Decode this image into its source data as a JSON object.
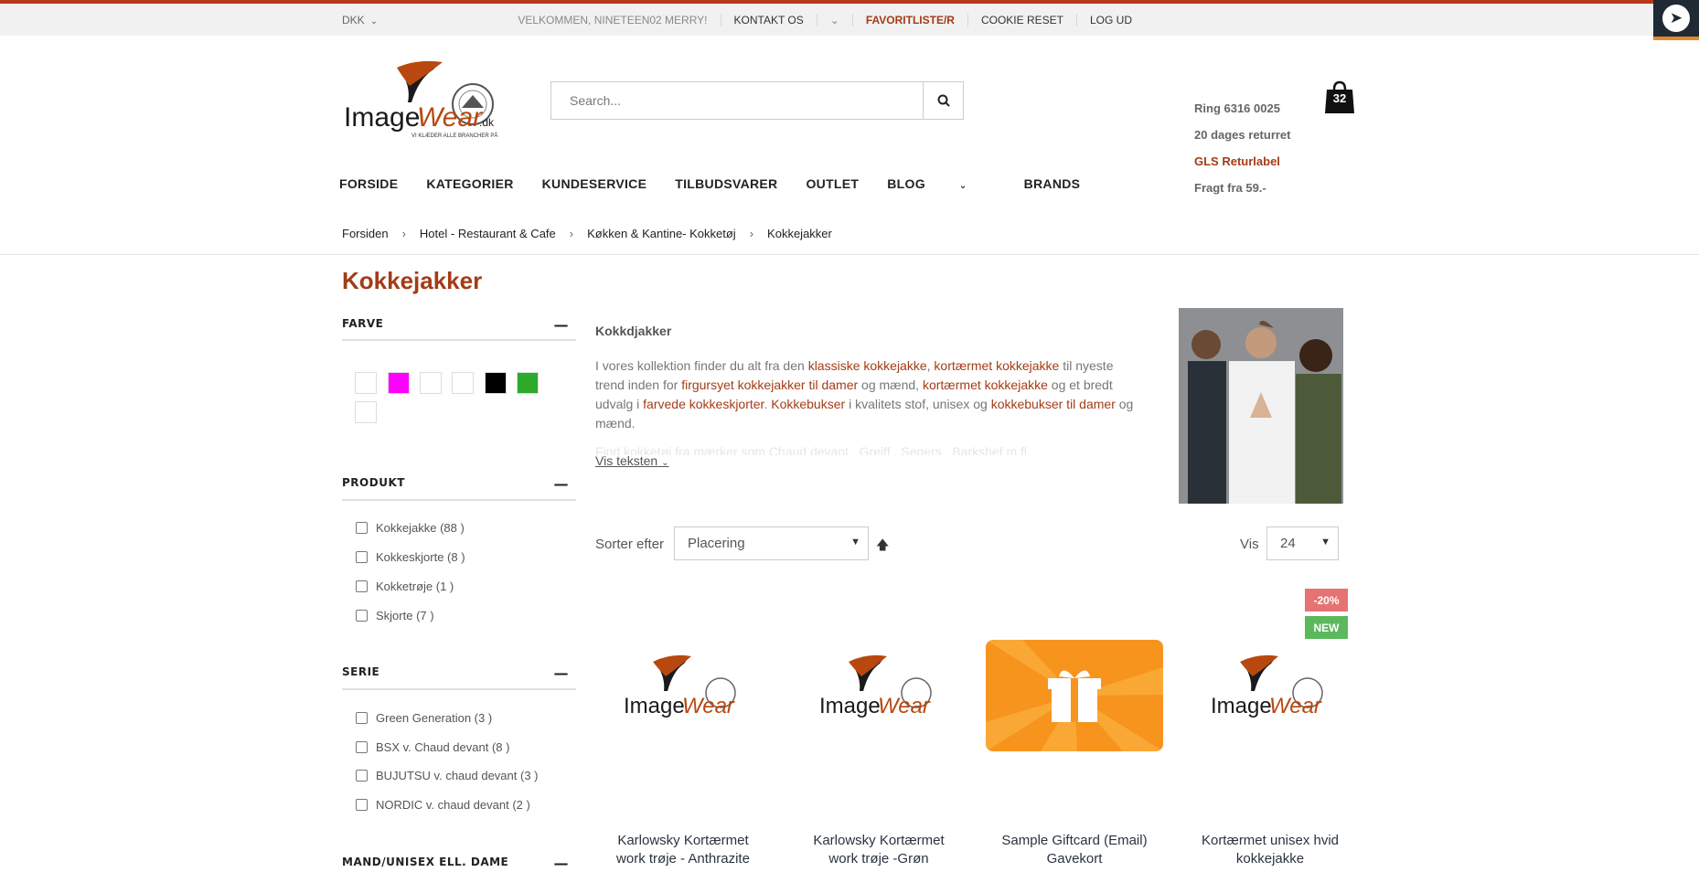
{
  "topbar": {
    "currency": "DKK",
    "welcome": "VELKOMMEN, NINETEEN02 MERRY!",
    "contact": "KONTAKT OS",
    "favorites": "FAVORITLISTE/R",
    "cookie": "COOKIE RESET",
    "logout": "LOG UD"
  },
  "logo_text": "ImageWear.dk",
  "logo_tagline": "VI KLÆDER ALLE BRANCHER PÅ",
  "search": {
    "placeholder": "Search..."
  },
  "info": {
    "phone": "Ring 6316 0025",
    "returns": "20 dages returret",
    "label": "GLS Returlabel",
    "shipping": "Fragt fra 59.-"
  },
  "cart": {
    "count": "32"
  },
  "nav": {
    "items": [
      "FORSIDE",
      "KATEGORIER",
      "KUNDESERVICE",
      "TILBUDSVARER",
      "OUTLET",
      "BLOG",
      "BRANDS"
    ]
  },
  "breadcrumb": [
    "Forsiden",
    "Hotel - Restaurant & Cafe",
    "Køkken & Kantine- Kokketøj",
    "Kokkejakker"
  ],
  "page_title": "Kokkejakker",
  "filters": {
    "farve": {
      "title": "FARVE",
      "swatches": [
        "#ffffff",
        "#ff00ff",
        "#ffffff",
        "#ffffff",
        "#000000",
        "#2eaa2e",
        "#ffffff"
      ]
    },
    "produkt": {
      "title": "PRODUKT",
      "options": [
        "Kokkejakke (88 )",
        "Kokkeskjorte (8 )",
        "Kokketrøje (1 )",
        "Skjorte (7 )"
      ]
    },
    "serie": {
      "title": "SERIE",
      "options": [
        "Green Generation (3 )",
        "BSX v. Chaud devant (8 )",
        "BUJUTSU v. chaud devant (3 )",
        "NORDIC v. chaud devant (2 )"
      ]
    },
    "mand": {
      "title": "MAND/UNISEX ELL. DAME"
    }
  },
  "description": {
    "title": "Kokkdjakker",
    "p1": "I vores kollektion finder du alt fra den",
    "l1": "klassiske kokkejakke",
    "p2": ",",
    "l2": "kortærmet kokkejakke",
    "p3": "til nyeste trend inden for",
    "l3": "firgursyet kokkejakker til damer",
    "p4": "og mænd,",
    "l4": "kortærmet kokkejakke",
    "p5": "og et bredt udvalg i",
    "l5": "farvede kokkeskjorter",
    "p6": ".",
    "l6": "Kokkebukser",
    "p7": "i kvalitets stof, unisex og",
    "l7": "kokkebukser til damer",
    "p8": "og mænd.",
    "fade": "Find kokketøj fra mærker som Chaud devant , Greiff , Segers , Barkshef m.fl.",
    "more": "Vis teksten"
  },
  "sort": {
    "label": "Sorter efter",
    "value": "Placering",
    "show_label": "Vis",
    "show_value": "24"
  },
  "badges": {
    "discount": "-20%",
    "new": "NEW",
    "discount_color": "#e57373",
    "new_color": "#5cb85c"
  },
  "products": [
    {
      "name1": "Karlowsky Kortærmet",
      "name2": "work trøje - Anthrazite"
    },
    {
      "name1": "Karlowsky Kortærmet",
      "name2": "work trøje -Grøn"
    },
    {
      "name1": "Sample Giftcard (Email)",
      "name2": "Gavekort"
    },
    {
      "name1": "Kortærmet unisex hvid",
      "name2": "kokkejakke"
    }
  ]
}
